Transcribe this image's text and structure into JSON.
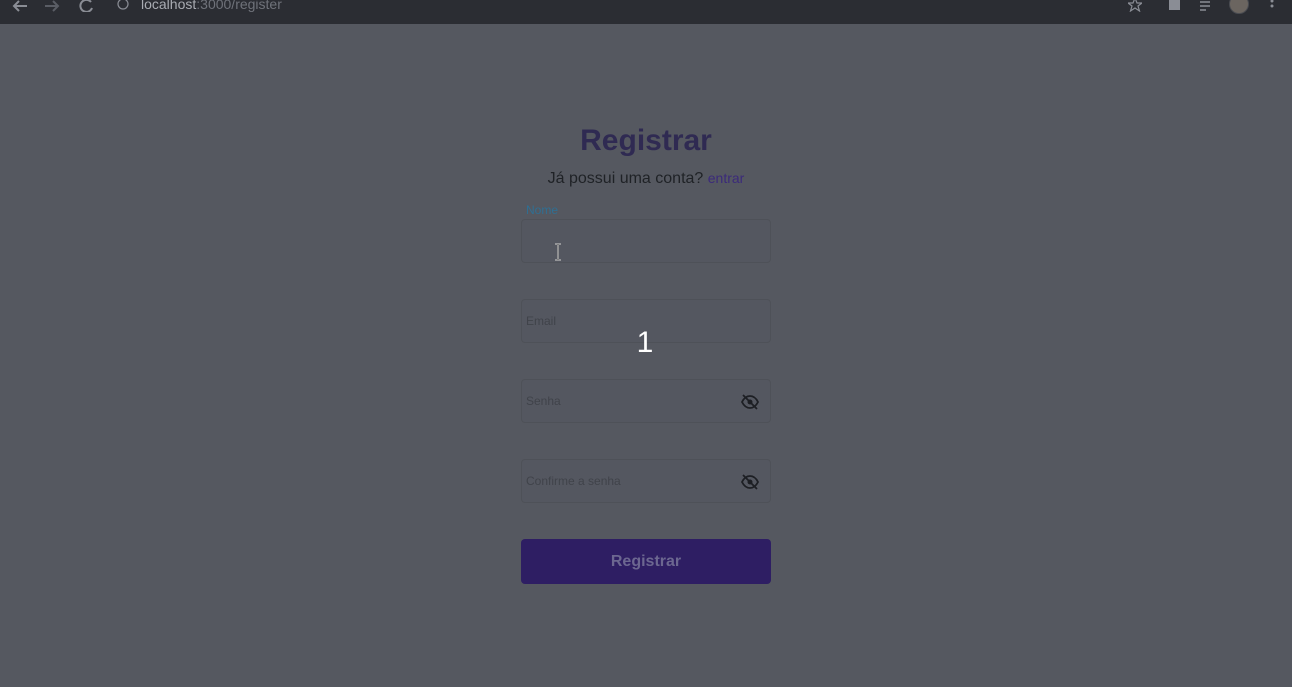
{
  "browser": {
    "url_host": "localhost",
    "url_path": ":3000/register"
  },
  "page": {
    "title": "Registrar",
    "subtitle": "Já possui uma conta?",
    "login_link": "entrar",
    "fields": {
      "name_label": "Nome",
      "email_placeholder": "Email",
      "password_placeholder": "Senha",
      "confirm_placeholder": "Confirme a senha"
    },
    "submit_label": "Registrar"
  },
  "overlay": {
    "step_number": "1"
  },
  "colors": {
    "accent": "#2e1e63",
    "background": "#555860"
  }
}
